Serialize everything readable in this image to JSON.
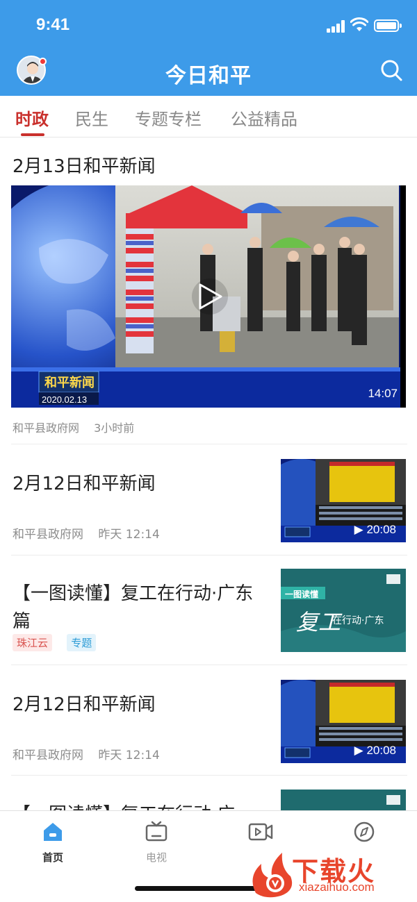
{
  "status_bar": {
    "time": "9:41"
  },
  "header": {
    "title": "今日和平"
  },
  "tabs": [
    {
      "label": "时政",
      "active": true
    },
    {
      "label": "民生",
      "active": false
    },
    {
      "label": "专题专栏",
      "active": false
    },
    {
      "label": "公益精品",
      "active": false
    }
  ],
  "hero": {
    "title": "2月13日和平新闻",
    "overlay_banner": "和平新闻",
    "overlay_date": "2020.02.13",
    "duration": "14:07",
    "source": "和平县政府网",
    "time": "3小时前"
  },
  "items": [
    {
      "title": "2月12日和平新闻",
      "source": "和平县政府网",
      "time": "昨天 12:14",
      "duration": "▶ 20:08"
    },
    {
      "title": "【一图读懂】复工在行动·广东篇",
      "tags": [
        "珠江云",
        "专题"
      ],
      "thumb_label": "一图读懂",
      "thumb_text_big": "复工",
      "thumb_text_small": "在行动·广东"
    },
    {
      "title": "2月12日和平新闻",
      "source": "和平县政府网",
      "time": "昨天 12:14",
      "duration": "▶ 20:08"
    },
    {
      "title": "【一图读懂】复工在行动·广"
    }
  ],
  "bottom_nav": [
    {
      "label": "首页",
      "icon": "home-icon",
      "active": true
    },
    {
      "label": "电视",
      "icon": "tv-icon",
      "active": false
    },
    {
      "label": "",
      "icon": "video-icon",
      "active": false
    },
    {
      "label": "",
      "icon": "compass-icon",
      "active": false
    }
  ],
  "watermark": {
    "text": "下载火",
    "url": "xiazaihuo.com"
  },
  "colors": {
    "header": "#3d9be9",
    "active_tab": "#c9302c",
    "tag_red": "#d9534f",
    "tag_blue": "#2d9cd6"
  }
}
